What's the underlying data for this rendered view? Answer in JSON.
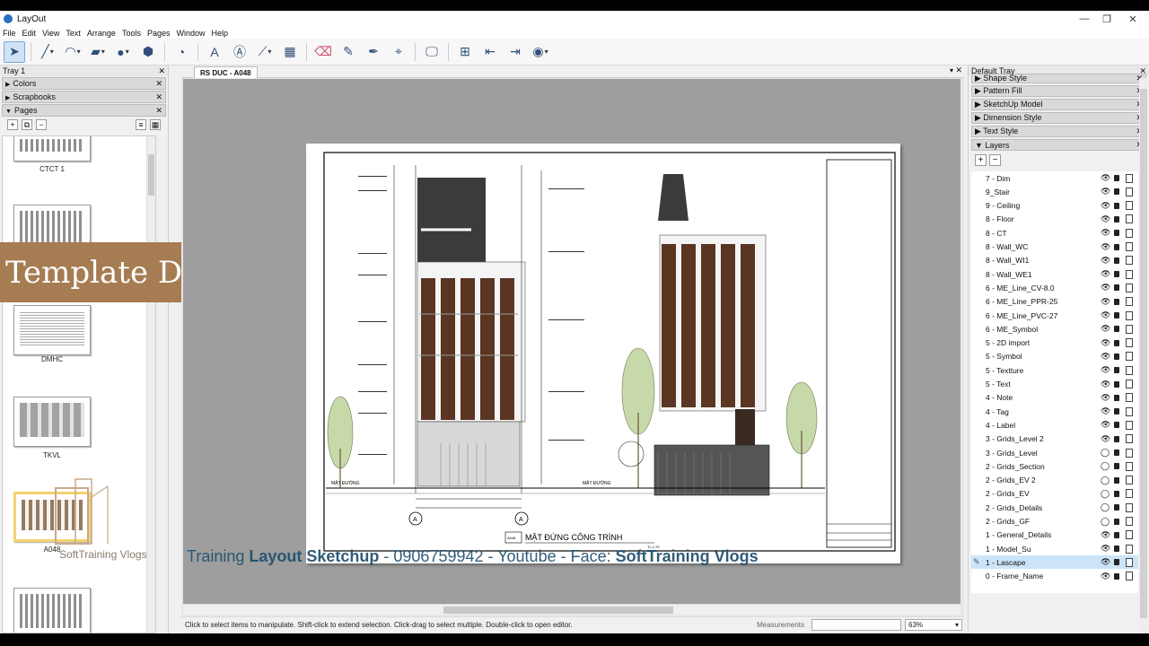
{
  "window": {
    "title": "LayOut",
    "minimize": "—",
    "maximize": "❐",
    "close": "✕"
  },
  "menu": [
    "File",
    "Edit",
    "View",
    "Text",
    "Arrange",
    "Tools",
    "Pages",
    "Window",
    "Help"
  ],
  "left_tray": {
    "title": "Tray 1",
    "panels": {
      "colors": "Colors",
      "scrapbooks": "Scrapbooks",
      "pages": "Pages"
    },
    "pages": [
      {
        "label": "CTCT 1"
      },
      {
        "label": ""
      },
      {
        "label": "DMHC"
      },
      {
        "label": "TKVL"
      },
      {
        "label": "A048"
      },
      {
        "label": ""
      }
    ]
  },
  "banner": {
    "text": "Template Dàn Trang Layou"
  },
  "document": {
    "tab": "RS DUC - A048",
    "drawing_title": "MẶT ĐỨNG CÔNG TRÌNH",
    "drawing_code": "A048",
    "scale": "TL 1:70",
    "ground_label": "MẶT ĐƯỜNG"
  },
  "status": {
    "message": "Click to select items to manipulate. Shift-click to extend selection. Click-drag to select multiple. Double-click to open editor.",
    "measurements_label": "Measurements",
    "zoom": "63%"
  },
  "overlay": {
    "logo_text": "SoftTraining Vlogs",
    "line_prefix": "Training ",
    "line_bold1": "Layout Sketchup",
    "line_mid": " - 0906759942 - Youtube - Face: ",
    "line_bold2": "SoftTraining Vlogs"
  },
  "right_tray": {
    "title": "Default Tray",
    "panels": [
      "Shape Style",
      "Pattern Fill",
      "SketchUp Model",
      "Dimension Style",
      "Text Style",
      "Layers"
    ],
    "layers": [
      "7 - Dim",
      "9_Stair",
      "9 - Ceiling",
      "8 - Floor",
      "8 - CT",
      "8 - Wall_WC",
      "8 - Wall_WI1",
      "8 - Wall_WE1",
      "6 - ME_Line_CV-8.0",
      "6 - ME_Line_PPR-25",
      "6 - ME_Line_PVC-27",
      "6 - ME_Symbol",
      "5 - 2D import",
      "5 - Symbol",
      "5 - Textture",
      "5 - Text",
      "4 - Note",
      "4 - Tag",
      "4 - Label",
      "3 - Grids_Level 2",
      "3 - Grids_Level",
      "2 - Grids_Section",
      "2 - Grids_EV 2",
      "2 - Grids_EV",
      "2 - Grids_Details",
      "2 - Grids_GF",
      "1 - General_Details",
      "1 - Model_Su",
      "1 - Lascape",
      "0 - Frame_Name"
    ],
    "selected_layer": "1 - Lascape"
  },
  "colors": {
    "banner": "#a67c52",
    "overlay_text": "#1f4f6e",
    "selection": "#cce4f7"
  }
}
